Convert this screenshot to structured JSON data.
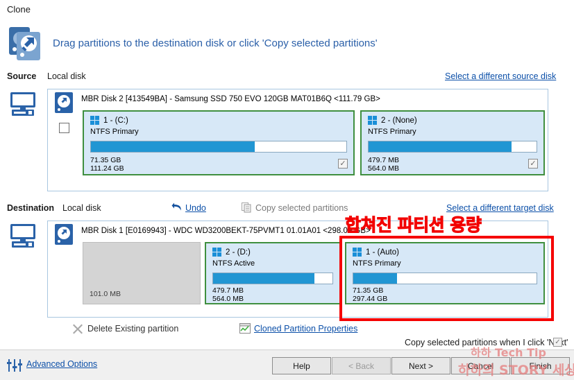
{
  "window": {
    "title": "Clone"
  },
  "header": {
    "icon": "clone-disks-icon",
    "instruction": "Drag partitions to the destination disk or click 'Copy selected partitions'"
  },
  "source": {
    "label": "Source",
    "type": "Local disk",
    "select_link": "Select a different source disk",
    "disk": {
      "title": "MBR Disk 2 [413549BA] - Samsung SSD 750 EVO 120GB MAT01B6Q  <111.79 GB>",
      "selected": false
    },
    "partitions": [
      {
        "name": "1 -  (C:)",
        "fs": "NTFS Primary",
        "used": "71.35 GB",
        "total": "111.24 GB",
        "fill_pct": 64,
        "checked": true
      },
      {
        "name": "2 -  (None)",
        "fs": "NTFS Primary",
        "used": "479.7 MB",
        "total": "564.0 MB",
        "fill_pct": 85,
        "checked": true
      }
    ]
  },
  "destination": {
    "label": "Destination",
    "type": "Local disk",
    "undo_label": "Undo",
    "copy_label": "Copy selected partitions",
    "select_link": "Select a different target disk",
    "disk": {
      "title": "MBR Disk 1 [E0169943] - WDC WD3200BEKT-75PVMT1 01.01A01  <298.09 GB>"
    },
    "unallocated": {
      "size": "101.0 MB"
    },
    "partitions": [
      {
        "name": "2 -  (D:)",
        "fs": "NTFS Active",
        "used": "479.7 MB",
        "total": "564.0 MB",
        "fill_pct": 85
      },
      {
        "name": "1 -  (Auto)",
        "fs": "NTFS Primary",
        "used": "71.35 GB",
        "total": "297.44 GB",
        "fill_pct": 24
      }
    ]
  },
  "annotation": {
    "text": "합쳐진 파티션 용량",
    "color": "#f20000"
  },
  "actions": {
    "delete_label": "Delete Existing partition",
    "properties_label": "Cloned Partition Properties",
    "copy_on_next_label": "Copy selected partitions when I click 'Next'",
    "copy_on_next_checked": true
  },
  "footer": {
    "advanced_options": "Advanced Options",
    "buttons": [
      {
        "label": "Help",
        "disabled": false
      },
      {
        "label": "< Back",
        "disabled": true
      },
      {
        "label": "Next >",
        "disabled": false
      },
      {
        "label": "Cancel",
        "disabled": false
      },
      {
        "label": "Finish",
        "disabled": false
      }
    ]
  },
  "watermark": {
    "line1": "하하 Tech Tip",
    "line2": "하하의 STORY 세상"
  }
}
